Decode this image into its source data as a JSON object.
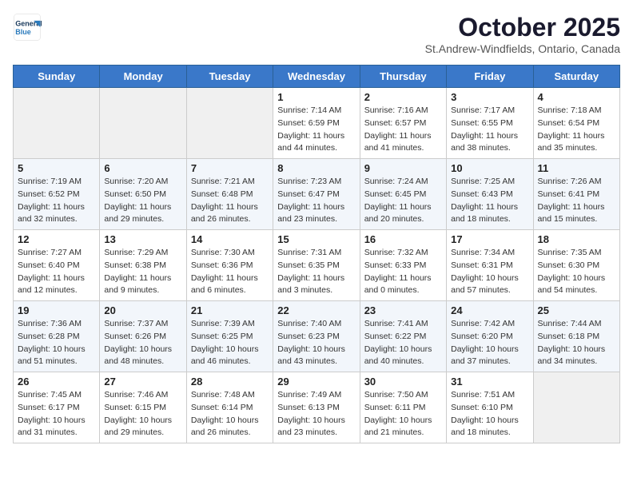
{
  "header": {
    "logo_line1": "General",
    "logo_line2": "Blue",
    "month": "October 2025",
    "location": "St.Andrew-Windfields, Ontario, Canada"
  },
  "days_of_week": [
    "Sunday",
    "Monday",
    "Tuesday",
    "Wednesday",
    "Thursday",
    "Friday",
    "Saturday"
  ],
  "weeks": [
    [
      {
        "day": "",
        "info": ""
      },
      {
        "day": "",
        "info": ""
      },
      {
        "day": "",
        "info": ""
      },
      {
        "day": "1",
        "info": "Sunrise: 7:14 AM\nSunset: 6:59 PM\nDaylight: 11 hours and 44 minutes."
      },
      {
        "day": "2",
        "info": "Sunrise: 7:16 AM\nSunset: 6:57 PM\nDaylight: 11 hours and 41 minutes."
      },
      {
        "day": "3",
        "info": "Sunrise: 7:17 AM\nSunset: 6:55 PM\nDaylight: 11 hours and 38 minutes."
      },
      {
        "day": "4",
        "info": "Sunrise: 7:18 AM\nSunset: 6:54 PM\nDaylight: 11 hours and 35 minutes."
      }
    ],
    [
      {
        "day": "5",
        "info": "Sunrise: 7:19 AM\nSunset: 6:52 PM\nDaylight: 11 hours and 32 minutes."
      },
      {
        "day": "6",
        "info": "Sunrise: 7:20 AM\nSunset: 6:50 PM\nDaylight: 11 hours and 29 minutes."
      },
      {
        "day": "7",
        "info": "Sunrise: 7:21 AM\nSunset: 6:48 PM\nDaylight: 11 hours and 26 minutes."
      },
      {
        "day": "8",
        "info": "Sunrise: 7:23 AM\nSunset: 6:47 PM\nDaylight: 11 hours and 23 minutes."
      },
      {
        "day": "9",
        "info": "Sunrise: 7:24 AM\nSunset: 6:45 PM\nDaylight: 11 hours and 20 minutes."
      },
      {
        "day": "10",
        "info": "Sunrise: 7:25 AM\nSunset: 6:43 PM\nDaylight: 11 hours and 18 minutes."
      },
      {
        "day": "11",
        "info": "Sunrise: 7:26 AM\nSunset: 6:41 PM\nDaylight: 11 hours and 15 minutes."
      }
    ],
    [
      {
        "day": "12",
        "info": "Sunrise: 7:27 AM\nSunset: 6:40 PM\nDaylight: 11 hours and 12 minutes."
      },
      {
        "day": "13",
        "info": "Sunrise: 7:29 AM\nSunset: 6:38 PM\nDaylight: 11 hours and 9 minutes."
      },
      {
        "day": "14",
        "info": "Sunrise: 7:30 AM\nSunset: 6:36 PM\nDaylight: 11 hours and 6 minutes."
      },
      {
        "day": "15",
        "info": "Sunrise: 7:31 AM\nSunset: 6:35 PM\nDaylight: 11 hours and 3 minutes."
      },
      {
        "day": "16",
        "info": "Sunrise: 7:32 AM\nSunset: 6:33 PM\nDaylight: 11 hours and 0 minutes."
      },
      {
        "day": "17",
        "info": "Sunrise: 7:34 AM\nSunset: 6:31 PM\nDaylight: 10 hours and 57 minutes."
      },
      {
        "day": "18",
        "info": "Sunrise: 7:35 AM\nSunset: 6:30 PM\nDaylight: 10 hours and 54 minutes."
      }
    ],
    [
      {
        "day": "19",
        "info": "Sunrise: 7:36 AM\nSunset: 6:28 PM\nDaylight: 10 hours and 51 minutes."
      },
      {
        "day": "20",
        "info": "Sunrise: 7:37 AM\nSunset: 6:26 PM\nDaylight: 10 hours and 48 minutes."
      },
      {
        "day": "21",
        "info": "Sunrise: 7:39 AM\nSunset: 6:25 PM\nDaylight: 10 hours and 46 minutes."
      },
      {
        "day": "22",
        "info": "Sunrise: 7:40 AM\nSunset: 6:23 PM\nDaylight: 10 hours and 43 minutes."
      },
      {
        "day": "23",
        "info": "Sunrise: 7:41 AM\nSunset: 6:22 PM\nDaylight: 10 hours and 40 minutes."
      },
      {
        "day": "24",
        "info": "Sunrise: 7:42 AM\nSunset: 6:20 PM\nDaylight: 10 hours and 37 minutes."
      },
      {
        "day": "25",
        "info": "Sunrise: 7:44 AM\nSunset: 6:18 PM\nDaylight: 10 hours and 34 minutes."
      }
    ],
    [
      {
        "day": "26",
        "info": "Sunrise: 7:45 AM\nSunset: 6:17 PM\nDaylight: 10 hours and 31 minutes."
      },
      {
        "day": "27",
        "info": "Sunrise: 7:46 AM\nSunset: 6:15 PM\nDaylight: 10 hours and 29 minutes."
      },
      {
        "day": "28",
        "info": "Sunrise: 7:48 AM\nSunset: 6:14 PM\nDaylight: 10 hours and 26 minutes."
      },
      {
        "day": "29",
        "info": "Sunrise: 7:49 AM\nSunset: 6:13 PM\nDaylight: 10 hours and 23 minutes."
      },
      {
        "day": "30",
        "info": "Sunrise: 7:50 AM\nSunset: 6:11 PM\nDaylight: 10 hours and 21 minutes."
      },
      {
        "day": "31",
        "info": "Sunrise: 7:51 AM\nSunset: 6:10 PM\nDaylight: 10 hours and 18 minutes."
      },
      {
        "day": "",
        "info": ""
      }
    ]
  ]
}
